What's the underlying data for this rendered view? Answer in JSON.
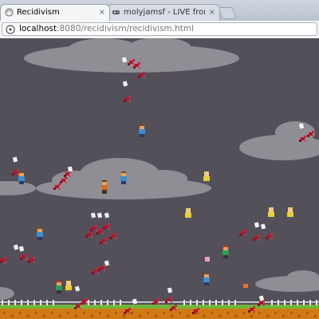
{
  "browser": {
    "tabs": [
      {
        "label": "Recidivism",
        "close_glyph": "×"
      },
      {
        "label": "molyjamsf - LIVE from my #",
        "close_glyph": "×"
      }
    ],
    "url_host": "localhost",
    "url_rest": ":8080/recidivism/recidivism.html"
  },
  "game": {
    "background_color": "#54505a",
    "cloud_color": "#8e8e94",
    "ground_color": "#d07a16",
    "grass_color": "#74b43a",
    "blood_color": "#b8142a"
  }
}
